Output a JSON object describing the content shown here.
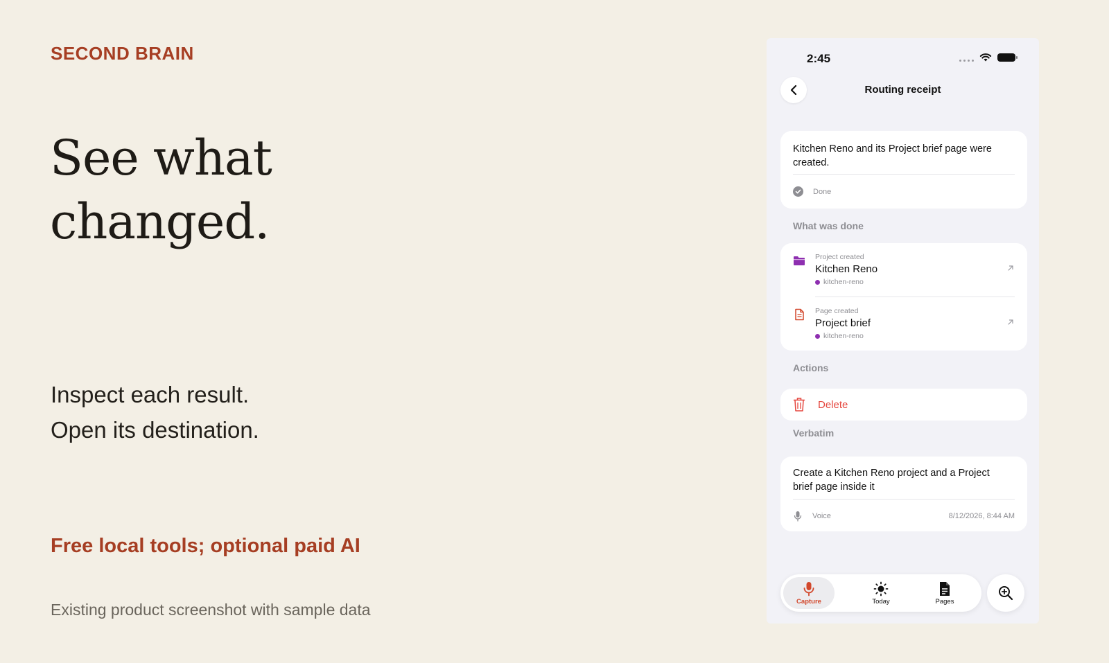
{
  "marketing": {
    "brand": "SECOND BRAIN",
    "headline_line1": "See what",
    "headline_line2": "changed.",
    "sub_line1": "Inspect each result.",
    "sub_line2": "Open its destination.",
    "pricing": "Free local tools; optional paid AI",
    "footnote": "Existing product screenshot with sample data"
  },
  "status_bar": {
    "time": "2:45"
  },
  "nav": {
    "title": "Routing receipt"
  },
  "summary": {
    "text": "Kitchen Reno and its Project brief page were created.",
    "status": "Done"
  },
  "what_was_done": {
    "label": "What was done",
    "items": [
      {
        "kind": "Project created",
        "title": "Kitchen Reno",
        "tag": "kitchen-reno"
      },
      {
        "kind": "Page created",
        "title": "Project brief",
        "tag": "kitchen-reno"
      }
    ]
  },
  "actions": {
    "label": "Actions",
    "delete_label": "Delete"
  },
  "verbatim": {
    "label": "Verbatim",
    "text": "Create a Kitchen Reno project and a Project brief page inside it",
    "source": "Voice",
    "timestamp": "8/12/2026, 8:44 AM"
  },
  "tabbar": {
    "tabs": [
      {
        "label": "Capture"
      },
      {
        "label": "Today"
      },
      {
        "label": "Pages"
      }
    ],
    "active": "Capture"
  },
  "colors": {
    "brand_accent": "#a63e23",
    "folder_icon": "#8e2fb0",
    "page_icon": "#d2472b",
    "delete": "#e5463e"
  }
}
